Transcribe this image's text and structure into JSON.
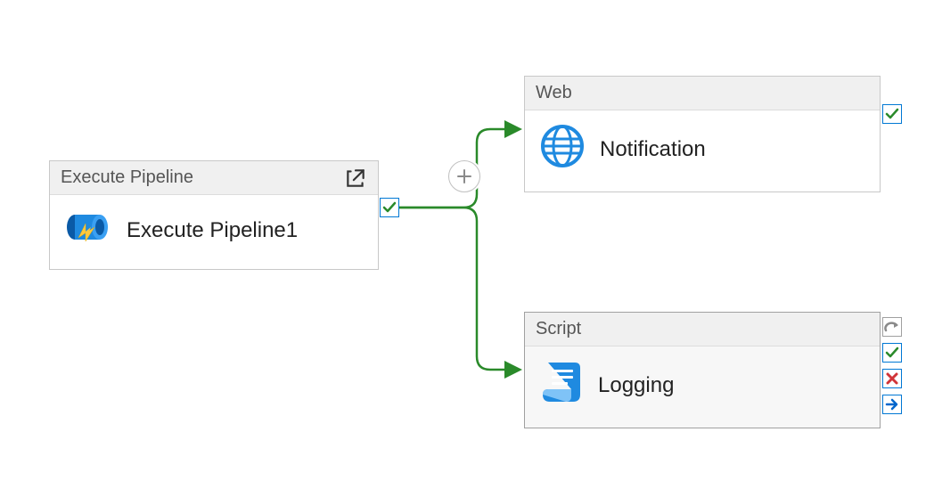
{
  "activities": {
    "executePipeline": {
      "type_label": "Execute Pipeline",
      "name": "Execute Pipeline1"
    },
    "web": {
      "type_label": "Web",
      "name": "Notification"
    },
    "script": {
      "type_label": "Script",
      "name": "Logging"
    }
  },
  "icons": {
    "popout": "open-in-new",
    "pipe": "execute-pipeline",
    "globe": "web-globe",
    "script": "script-scroll",
    "plus": "add-activity",
    "check": "success-check",
    "retry": "retry-arrow",
    "cross": "failure-x",
    "arrow": "completion-arrow"
  },
  "colors": {
    "success": "#2a8a2a",
    "azureBlue": "#0078d4",
    "fail": "#d13438",
    "gray": "#8a8a8a"
  }
}
